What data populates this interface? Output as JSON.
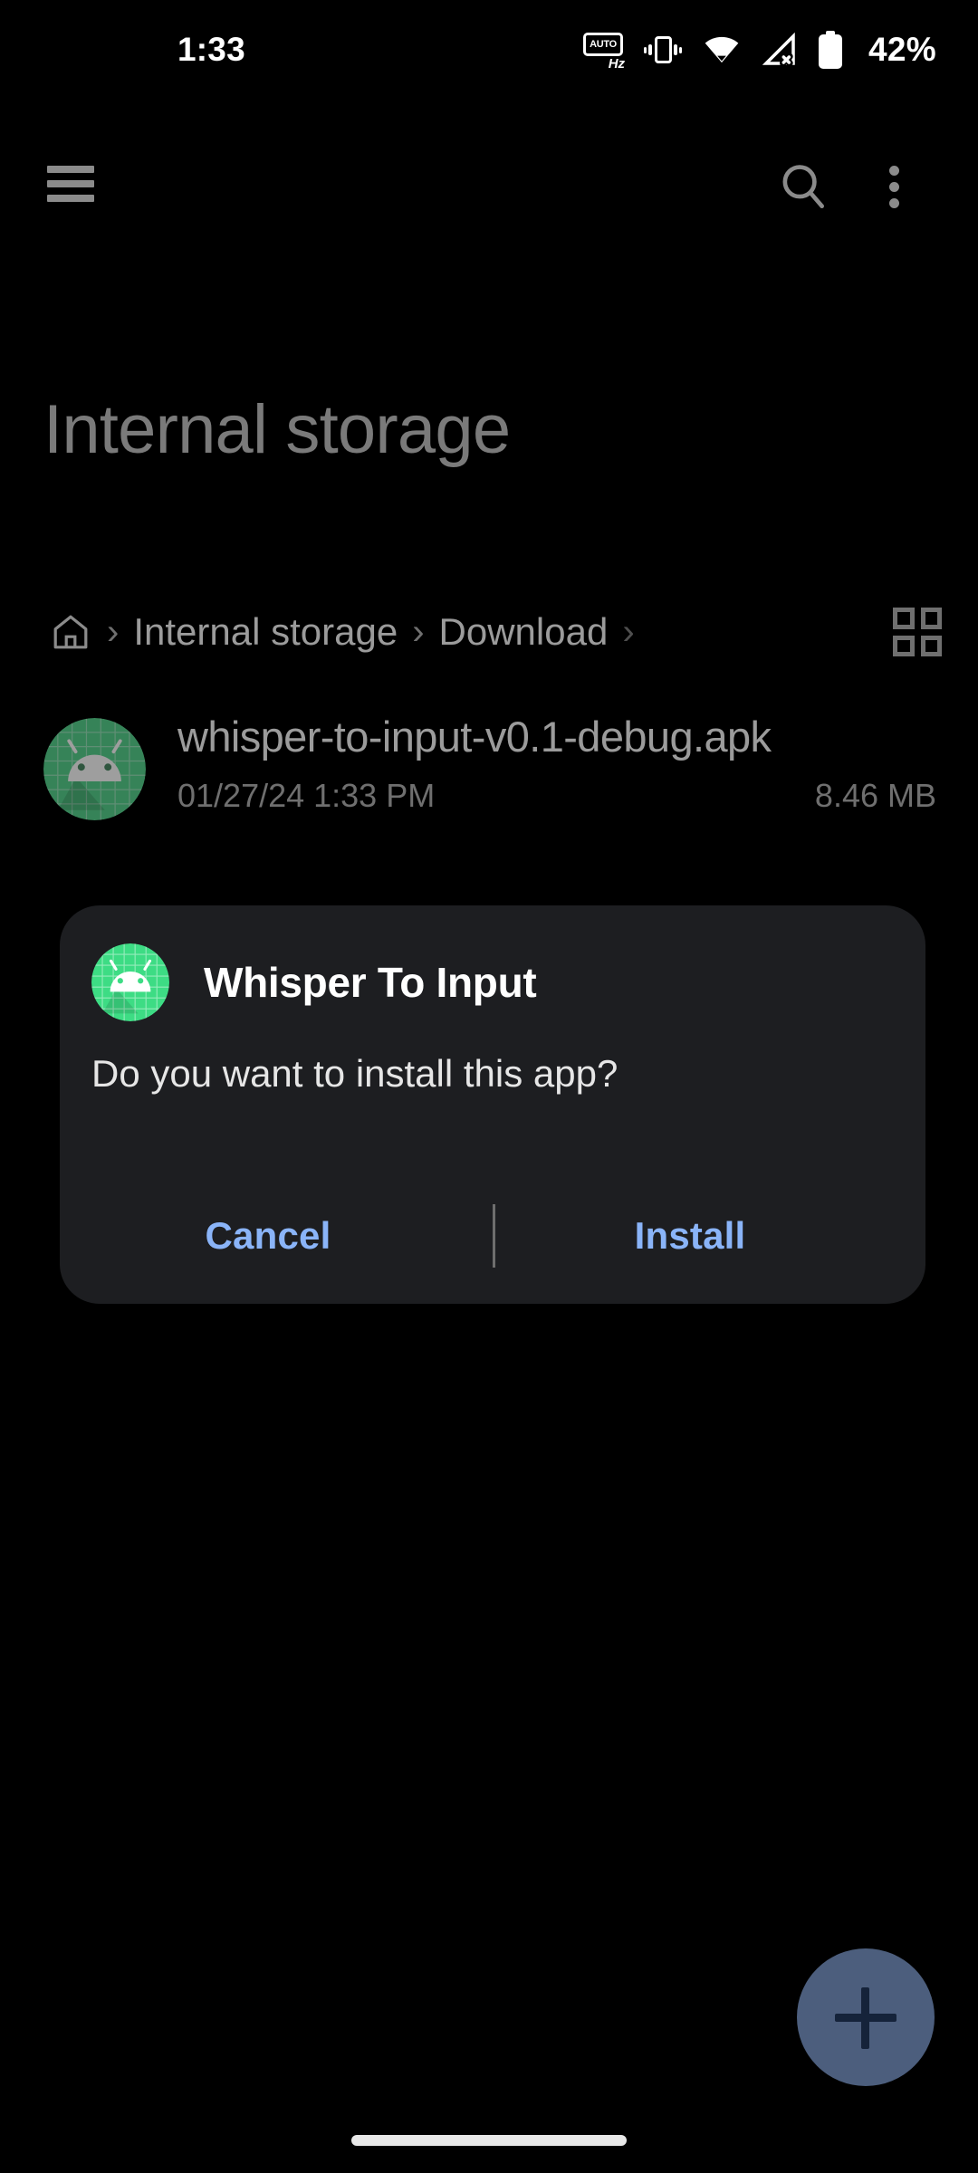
{
  "status_bar": {
    "clock": "1:33",
    "battery_percent": "42%",
    "auto_hz_label": "AUTO",
    "auto_hz_unit": "Hz",
    "icons": [
      "auto-hz-icon",
      "vibrate-icon",
      "wifi-icon",
      "cellular-off-icon",
      "battery-icon"
    ]
  },
  "toolbar": {
    "menu_icon": "hamburger-menu-icon",
    "search_icon": "search-icon",
    "overflow_icon": "more-vertical-icon"
  },
  "page": {
    "title": "Internal storage"
  },
  "breadcrumb": {
    "home_icon": "home-icon",
    "separator": "›",
    "items": [
      {
        "label": "Internal storage"
      },
      {
        "label": "Download"
      }
    ],
    "view_toggle_icon": "grid-view-icon"
  },
  "file_list": {
    "items": [
      {
        "icon": "apk-android-icon",
        "name": "whisper-to-input-v0.1-debug.apk",
        "date": "01/27/24 1:33 PM",
        "size": "8.46 MB"
      }
    ]
  },
  "dialog": {
    "icon": "apk-android-icon",
    "title": "Whisper To Input",
    "message": "Do you want to install this app?",
    "cancel_label": "Cancel",
    "install_label": "Install",
    "accent_color": "#8ab4f8",
    "background_color": "#1d1e21"
  },
  "fab": {
    "icon": "plus-icon",
    "background_color": "#4c5e7d"
  },
  "nav_bar": {
    "gesture_pill": "gesture-home-pill"
  },
  "theme": {
    "background": "#000000",
    "text_primary": "#9b9b9b",
    "text_secondary": "#6f6f6f",
    "android_green": "#3ddc84"
  }
}
